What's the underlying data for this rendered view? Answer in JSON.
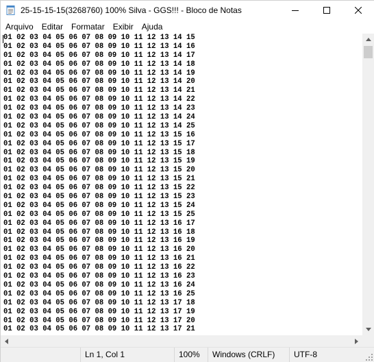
{
  "window": {
    "title": "25-15-15-15(3268760) 100% Silva - GGS!!! - Bloco de Notas",
    "icons": {
      "app": "notepad-icon",
      "minimize": "minimize-icon",
      "maximize": "maximize-icon",
      "close": "close-icon"
    }
  },
  "menu": {
    "items": [
      "Arquivo",
      "Editar",
      "Formatar",
      "Exibir",
      "Ajuda"
    ]
  },
  "editor": {
    "lines": [
      "01 02 03 04 05 06 07 08 09 10 11 12 13 14 15",
      "01 02 03 04 05 06 07 08 09 10 11 12 13 14 16",
      "01 02 03 04 05 06 07 08 09 10 11 12 13 14 17",
      "01 02 03 04 05 06 07 08 09 10 11 12 13 14 18",
      "01 02 03 04 05 06 07 08 09 10 11 12 13 14 19",
      "01 02 03 04 05 06 07 08 09 10 11 12 13 14 20",
      "01 02 03 04 05 06 07 08 09 10 11 12 13 14 21",
      "01 02 03 04 05 06 07 08 09 10 11 12 13 14 22",
      "01 02 03 04 05 06 07 08 09 10 11 12 13 14 23",
      "01 02 03 04 05 06 07 08 09 10 11 12 13 14 24",
      "01 02 03 04 05 06 07 08 09 10 11 12 13 14 25",
      "01 02 03 04 05 06 07 08 09 10 11 12 13 15 16",
      "01 02 03 04 05 06 07 08 09 10 11 12 13 15 17",
      "01 02 03 04 05 06 07 08 09 10 11 12 13 15 18",
      "01 02 03 04 05 06 07 08 09 10 11 12 13 15 19",
      "01 02 03 04 05 06 07 08 09 10 11 12 13 15 20",
      "01 02 03 04 05 06 07 08 09 10 11 12 13 15 21",
      "01 02 03 04 05 06 07 08 09 10 11 12 13 15 22",
      "01 02 03 04 05 06 07 08 09 10 11 12 13 15 23",
      "01 02 03 04 05 06 07 08 09 10 11 12 13 15 24",
      "01 02 03 04 05 06 07 08 09 10 11 12 13 15 25",
      "01 02 03 04 05 06 07 08 09 10 11 12 13 16 17",
      "01 02 03 04 05 06 07 08 09 10 11 12 13 16 18",
      "01 02 03 04 05 06 07 08 09 10 11 12 13 16 19",
      "01 02 03 04 05 06 07 08 09 10 11 12 13 16 20",
      "01 02 03 04 05 06 07 08 09 10 11 12 13 16 21",
      "01 02 03 04 05 06 07 08 09 10 11 12 13 16 22",
      "01 02 03 04 05 06 07 08 09 10 11 12 13 16 23",
      "01 02 03 04 05 06 07 08 09 10 11 12 13 16 24",
      "01 02 03 04 05 06 07 08 09 10 11 12 13 16 25",
      "01 02 03 04 05 06 07 08 09 10 11 12 13 17 18",
      "01 02 03 04 05 06 07 08 09 10 11 12 13 17 19",
      "01 02 03 04 05 06 07 08 09 10 11 12 13 17 20",
      "01 02 03 04 05 06 07 08 09 10 11 12 13 17 21"
    ]
  },
  "status": {
    "position": "Ln 1, Col 1",
    "zoom": "100%",
    "line_ending": "Windows (CRLF)",
    "encoding": "UTF-8"
  },
  "scroll": {
    "vertical_thumb_position": 0.0
  }
}
